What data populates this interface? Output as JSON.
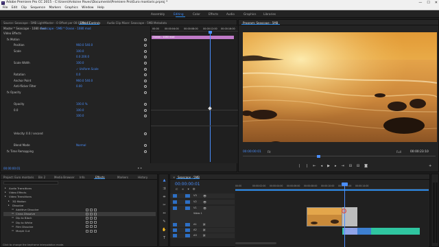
{
  "window": {
    "title": "Adobe Premiere Pro CC 2015 - C:\\Users\\Antoine Pavec\\Documents\\Premiere Pro\\Euro montaris.prproj *",
    "minimize": "—",
    "maximize": "☐",
    "close": "✕"
  },
  "menu": [
    "File",
    "Edit",
    "Clip",
    "Sequence",
    "Markers",
    "Graphics",
    "Window",
    "Help"
  ],
  "workspaces": [
    "Assembly",
    "Editing",
    "Color",
    "Effects",
    "Audio",
    "Graphics",
    "Libraries"
  ],
  "workspaces_active": "Editing",
  "source_panel": {
    "tabs": [
      "Source: Seascape - 5MB LightMaster - 0 Offset per 00:03:04:23",
      "Effect Controls",
      "Audio Clip Mixer: Seascape - 5MB",
      "Metadata"
    ],
    "active_tab": "Effect Controls",
    "master_line": "Master * Seascape - 1080 mod",
    "clip_line": "Seascape - 5MB * Ocean - 1080 mod",
    "ruler_times": [
      "00:00",
      "00:00:04:00",
      "00:00:08:00",
      "00:00:12:00",
      "00:00:16:00"
    ],
    "clip_bar_label": "Ocean - 1080 mod",
    "sections": [
      {
        "label": "Video Effects",
        "value": "",
        "indent": 0
      },
      {
        "label": "fx  Motion",
        "value": "",
        "indent": 1
      },
      {
        "label": "Position",
        "value": "960.0    540.0",
        "indent": 3
      },
      {
        "label": "Scale",
        "value": "100.0",
        "indent": 3
      },
      {
        "label": "",
        "value": "0.0                                              200.0",
        "indent": 3
      },
      {
        "label": "Scale Width",
        "value": "100.0",
        "indent": 3
      },
      {
        "label": "",
        "value": "✓ Uniform Scale",
        "indent": 3
      },
      {
        "label": "Rotation",
        "value": "0.0",
        "indent": 3
      },
      {
        "label": "Anchor Point",
        "value": "960.0    540.0",
        "indent": 3
      },
      {
        "label": "Anti-flicker Filter",
        "value": "0.00",
        "indent": 3
      },
      {
        "label": "fx  Opacity",
        "value": "",
        "indent": 1
      },
      {
        "label": "",
        "value": "",
        "indent": 3
      },
      {
        "label": "Opacity",
        "value": "100.0 %",
        "indent": 3
      },
      {
        "label": "0.0",
        "value": "100.0",
        "indent": 3
      },
      {
        "label": "",
        "value": "100.0",
        "indent": 3
      },
      {
        "label": "",
        "value": "",
        "indent": 3
      },
      {
        "label": "",
        "value": "",
        "indent": 3
      },
      {
        "label": "Velocity: 0.0 / second",
        "value": "",
        "indent": 3
      },
      {
        "label": "",
        "value": "",
        "indent": 3
      },
      {
        "label": "Blend Mode",
        "value": "Normal",
        "indent": 3
      },
      {
        "label": "fx  Time Remapping",
        "value": "",
        "indent": 1
      }
    ],
    "timecode": "00:00:00:01"
  },
  "program_panel": {
    "tab": "Program: Seascape - 5MB",
    "timecode_left": "00:00:00:01",
    "fit": "Fit",
    "full": "Full",
    "timecode_right": "00:00:23:10"
  },
  "project_panel": {
    "tabs": [
      "Project: Euro montaris",
      "Bin 2",
      "Media Browser",
      "Info",
      "Effects",
      "Markers",
      "History"
    ],
    "active_tab": "Effects",
    "items": [
      {
        "label": "Audio Transitions",
        "level": 0
      },
      {
        "label": "Video Effects",
        "level": 0
      },
      {
        "label": "Video Transitions",
        "level": 0
      },
      {
        "label": "3D Motion",
        "level": 1
      },
      {
        "label": "Dissolve",
        "level": 1
      },
      {
        "label": "Additive Dissolve",
        "level": 2
      },
      {
        "label": "Cross Dissolve",
        "level": 2
      },
      {
        "label": "Dip to Black",
        "level": 2
      },
      {
        "label": "Dip to White",
        "level": 2
      },
      {
        "label": "Film Dissolve",
        "level": 2
      },
      {
        "label": "Morph Cut",
        "level": 2
      }
    ],
    "selected_index": 6
  },
  "timeline": {
    "tab": "Seascape - 5MB",
    "timecode": "00:00:00:01",
    "ruler": [
      "00:00",
      "00:00:02:00",
      "00:00:04:00",
      "00:00:06:00",
      "00:00:08:00",
      "00:00:10:00",
      "00:00:12:00",
      "00:00:14:00"
    ],
    "video_tracks": [
      "V3",
      "V2",
      "V1"
    ],
    "audio_tracks": [
      "A1",
      "A2",
      "A3"
    ],
    "video_label": "Video 1",
    "audio_clip_label": "Ocean - 1080 mod"
  },
  "status": {
    "text": "Click to change the keyframe interpolation mode."
  },
  "colors": {
    "accent": "#2d8ceb",
    "clip_video": "#9aa0f0",
    "clip_audio": "#2fc5a0",
    "playhead": "#4a8fff"
  }
}
